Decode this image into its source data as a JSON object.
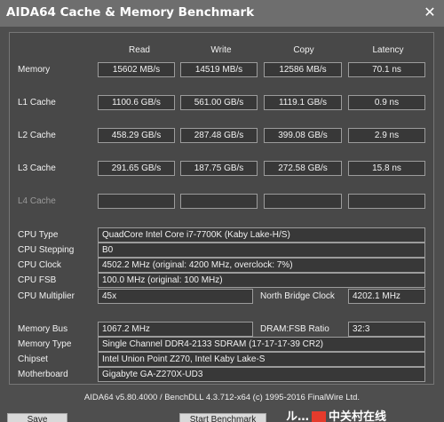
{
  "window": {
    "title": "AIDA64 Cache & Memory Benchmark",
    "close_glyph": "✕"
  },
  "columns": [
    "Read",
    "Write",
    "Copy",
    "Latency"
  ],
  "cache_rows": [
    {
      "label": "Memory",
      "values": [
        "15602 MB/s",
        "14519 MB/s",
        "12586 MB/s",
        "70.1 ns"
      ],
      "enabled": true
    },
    {
      "label": "L1 Cache",
      "values": [
        "1100.6 GB/s",
        "561.00 GB/s",
        "1119.1 GB/s",
        "0.9 ns"
      ],
      "enabled": true
    },
    {
      "label": "L2 Cache",
      "values": [
        "458.29 GB/s",
        "287.48 GB/s",
        "399.08 GB/s",
        "2.9 ns"
      ],
      "enabled": true
    },
    {
      "label": "L3 Cache",
      "values": [
        "291.65 GB/s",
        "187.75 GB/s",
        "272.58 GB/s",
        "15.8 ns"
      ],
      "enabled": true
    },
    {
      "label": "L4 Cache",
      "values": [
        "",
        "",
        "",
        ""
      ],
      "enabled": false
    }
  ],
  "cpu": {
    "type_label": "CPU Type",
    "type_value": "QuadCore Intel Core i7-7700K  (Kaby Lake-H/S)",
    "stepping_label": "CPU Stepping",
    "stepping_value": "B0",
    "clock_label": "CPU Clock",
    "clock_value": "4502.2 MHz  (original: 4200 MHz, overclock: 7%)",
    "fsb_label": "CPU FSB",
    "fsb_value": "100.0 MHz  (original: 100 MHz)",
    "multiplier_label": "CPU Multiplier",
    "multiplier_value": "45x",
    "nb_clock_label": "North Bridge Clock",
    "nb_clock_value": "4202.1 MHz"
  },
  "memory": {
    "bus_label": "Memory Bus",
    "bus_value": "1067.2 MHz",
    "ratio_label": "DRAM:FSB Ratio",
    "ratio_value": "32:3",
    "type_label": "Memory Type",
    "type_value": "Single Channel DDR4-2133 SDRAM  (17-17-17-39 CR2)",
    "chipset_label": "Chipset",
    "chipset_value": "Intel Union Point Z270, Intel Kaby Lake-S",
    "motherboard_label": "Motherboard",
    "motherboard_value": "Gigabyte GA-Z270X-UD3"
  },
  "footer_text": "AIDA64 v5.80.4000 / BenchDLL 4.3.712-x64  (c) 1995-2016 FinalWire Ltd.",
  "buttons": {
    "save": "Save",
    "start": "Start Benchmark"
  },
  "watermark": {
    "text_left": "ル…",
    "text_right": "中关村在线"
  }
}
